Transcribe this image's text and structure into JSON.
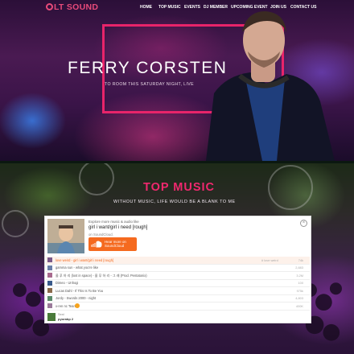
{
  "brand": {
    "logo_text": "LT SOUND",
    "accent": "#e84a7a"
  },
  "nav": {
    "items": [
      "HOME",
      "TOP MUSIC",
      "EVENTS",
      "DJ MEMBER",
      "UPCOMING EVENT",
      "JOIN US",
      "CONTACT US"
    ]
  },
  "hero": {
    "title": "FERRY CORSTEN",
    "subtitle": "TO ROOM THIS SATURDAY NIGHT, LIVE",
    "frame_color": "#e8246a"
  },
  "top_music": {
    "title": "TOP MUSIC",
    "subtitle": "WITHOUT MUSIC, LIFE WOULD BE A BLANK TO ME",
    "title_color": "#f0286e"
  },
  "widget": {
    "explore": "Explore more music & audio like",
    "track": "girl i want/girl i need [rough]",
    "on": "on SoundCloud.",
    "button_label": "Hear more on SoundCloud",
    "close_icon": "close-icon",
    "button_color": "#f56a1f",
    "tracks": [
      {
        "title": "love weird - girl i want/girl i need [rough]",
        "tag": "# love weird",
        "plays": "74k"
      },
      {
        "title": "gamma sun - what you're like",
        "tag": "",
        "plays": "2,883"
      },
      {
        "title": "울 푸 하 리 (lost in space) - 울 푸 하 리 - 그 래 (Prod. Pentatonix)",
        "tag": "",
        "plays": "3.2M"
      },
      {
        "title": "Dimeo - Unhogi",
        "tag": "",
        "plays": "100"
      },
      {
        "title": "Lucas Dahl - If This Is To Be You",
        "tag": "",
        "plays": "975k"
      },
      {
        "title": "Jordy - Swords 2000 - night",
        "tag": "",
        "plays": "4,803"
      },
      {
        "title": "x-ren nc Teares",
        "tag": "",
        "plays": "400K"
      }
    ],
    "footer_line1": "Seal",
    "footer_line2": "pyorabp 2"
  }
}
